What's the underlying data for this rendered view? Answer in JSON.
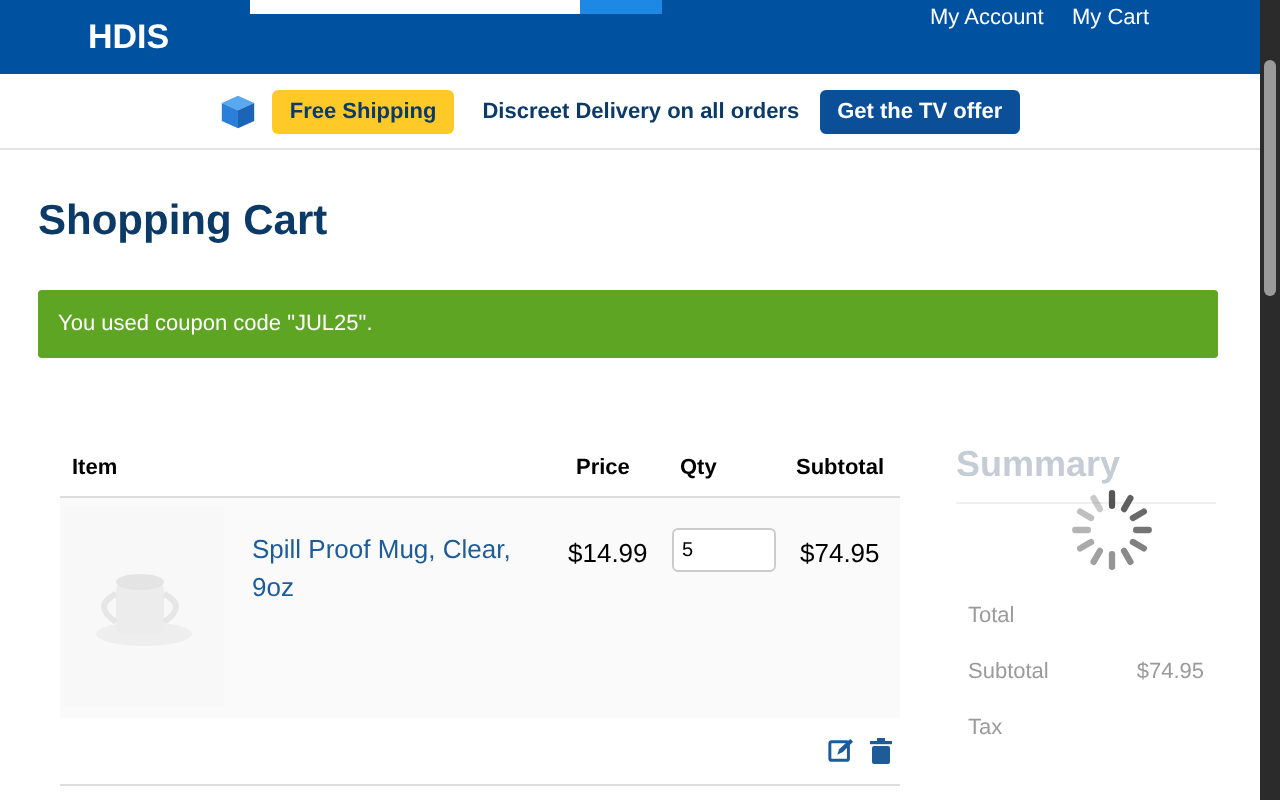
{
  "header": {
    "logo": "HDIS",
    "account": "My Account",
    "cart": "My Cart"
  },
  "promo": {
    "badge": "Free Shipping",
    "message": "Discreet Delivery on all orders",
    "offer": "Get the TV offer"
  },
  "title": "Shopping Cart",
  "alert": "You used coupon code \"JUL25\".",
  "table": {
    "columns": [
      "Item",
      "Price",
      "Qty",
      "Subtotal"
    ],
    "rows": [
      {
        "name": "Spill Proof Mug, Clear, 9oz",
        "price": "$14.99",
        "qty": "5",
        "subtotal": "$74.95"
      }
    ]
  },
  "summary": {
    "title": "Summary",
    "total": "Total",
    "lines": [
      {
        "label": "Subtotal",
        "value": "$74.95"
      },
      {
        "label": "Tax"
      }
    ],
    "loading": true
  }
}
